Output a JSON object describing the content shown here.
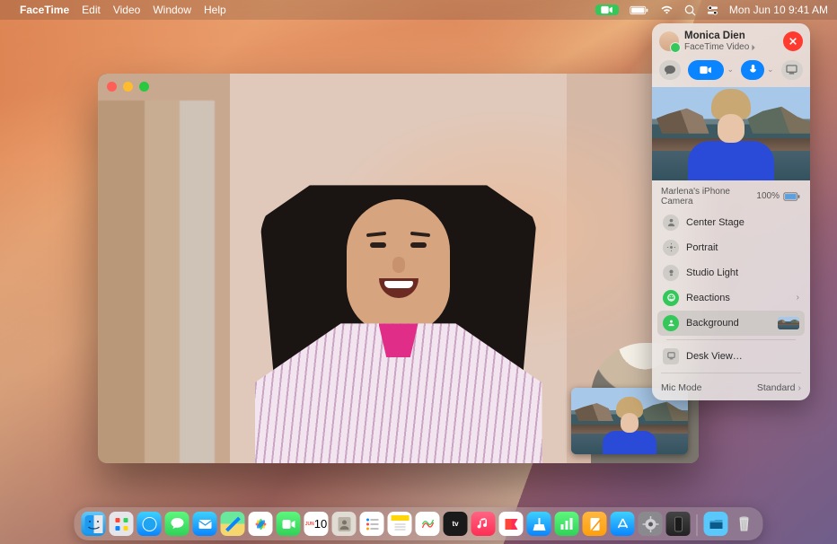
{
  "menubar": {
    "app": "FaceTime",
    "items": [
      "Edit",
      "Video",
      "Window",
      "Help"
    ],
    "datetime": "Mon Jun 10  9:41 AM"
  },
  "panel": {
    "name": "Monica Dien",
    "subtitle": "FaceTime Video",
    "camera_label": "Marlena's iPhone Camera",
    "battery_pct": "100%",
    "options": {
      "center_stage": "Center Stage",
      "portrait": "Portrait",
      "studio_light": "Studio Light",
      "reactions": "Reactions",
      "background": "Background",
      "desk_view": "Desk View…"
    },
    "mic_mode_label": "Mic Mode",
    "mic_mode_value": "Standard"
  },
  "dock": {
    "items": [
      {
        "name": "finder"
      },
      {
        "name": "launchpad"
      },
      {
        "name": "safari"
      },
      {
        "name": "messages"
      },
      {
        "name": "mail"
      },
      {
        "name": "maps"
      },
      {
        "name": "photos"
      },
      {
        "name": "facetime"
      },
      {
        "name": "calendar",
        "day": "10",
        "mon": "JUN"
      },
      {
        "name": "contacts"
      },
      {
        "name": "reminders"
      },
      {
        "name": "notes"
      },
      {
        "name": "freeform"
      },
      {
        "name": "tv"
      },
      {
        "name": "music"
      },
      {
        "name": "news"
      },
      {
        "name": "podcasts"
      },
      {
        "name": "numbers"
      },
      {
        "name": "pages"
      },
      {
        "name": "appstore"
      },
      {
        "name": "settings"
      },
      {
        "name": "iphone-mirroring"
      }
    ]
  },
  "colors": {
    "accent_blue": "#0a84ff",
    "accent_green": "#34c759",
    "close_red": "#ff3b30"
  }
}
